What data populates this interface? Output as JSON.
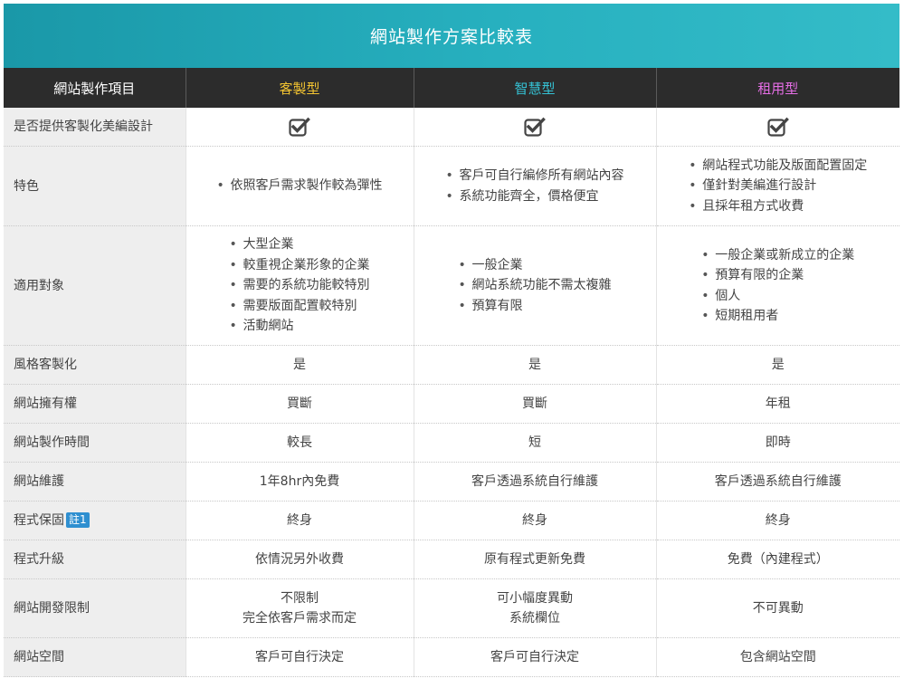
{
  "banner": {
    "title": "網站製作方案比較表"
  },
  "header": {
    "item_label": "網站製作項目",
    "plans": [
      "客製型",
      "智慧型",
      "租用型"
    ]
  },
  "colors": {
    "banner": "#27b0bf",
    "header_bg": "#2c2c2c",
    "custom": "#f5c531",
    "smart": "#35c3d6",
    "rental": "#e66ee6",
    "badge": "#2f8fd0"
  },
  "rows": {
    "design": {
      "label": "是否提供客製化美編設計",
      "icon": "checkbox-checked-icon"
    },
    "features": {
      "label": "特色",
      "custom": [
        "依照客戶需求製作較為彈性"
      ],
      "smart": [
        "客戶可自行編修所有網站內容",
        "系統功能齊全，價格便宜"
      ],
      "rental": [
        "網站程式功能及版面配置固定",
        "僅針對美編進行設計",
        "且採年租方式收費"
      ]
    },
    "audience": {
      "label": "適用對象",
      "custom": [
        "大型企業",
        "較重視企業形象的企業",
        "需要的系統功能較特別",
        "需要版面配置較特別",
        "活動網站"
      ],
      "smart": [
        "一般企業",
        "網站系統功能不需太複雜",
        "預算有限"
      ],
      "rental": [
        "一般企業或新成立的企業",
        "預算有限的企業",
        "個人",
        "短期租用者"
      ]
    },
    "style": {
      "label": "風格客製化",
      "custom": "是",
      "smart": "是",
      "rental": "是"
    },
    "ownership": {
      "label": "網站擁有權",
      "custom": "買斷",
      "smart": "買斷",
      "rental": "年租"
    },
    "time": {
      "label": "網站製作時間",
      "custom": "較長",
      "smart": "短",
      "rental": "即時"
    },
    "maintenance": {
      "label": "網站維護",
      "custom": "1年8hr內免費",
      "smart": "客戶透過系統自行維護",
      "rental": "客戶透過系統自行維護"
    },
    "warranty": {
      "label": "程式保固",
      "badge": "註1",
      "custom": "終身",
      "smart": "終身",
      "rental": "終身"
    },
    "upgrade": {
      "label": "程式升級",
      "custom": "依情況另外收費",
      "smart": "原有程式更新免費",
      "rental": "免費（內建程式）"
    },
    "dev_limit": {
      "label": "網站開發限制",
      "custom": [
        "不限制",
        "完全依客戶需求而定"
      ],
      "smart": [
        "可小幅度異動",
        "系統欄位"
      ],
      "rental": "不可異動"
    },
    "space": {
      "label": "網站空間",
      "custom": "客戶可自行決定",
      "smart": "客戶可自行決定",
      "rental": "包含網站空間"
    }
  }
}
